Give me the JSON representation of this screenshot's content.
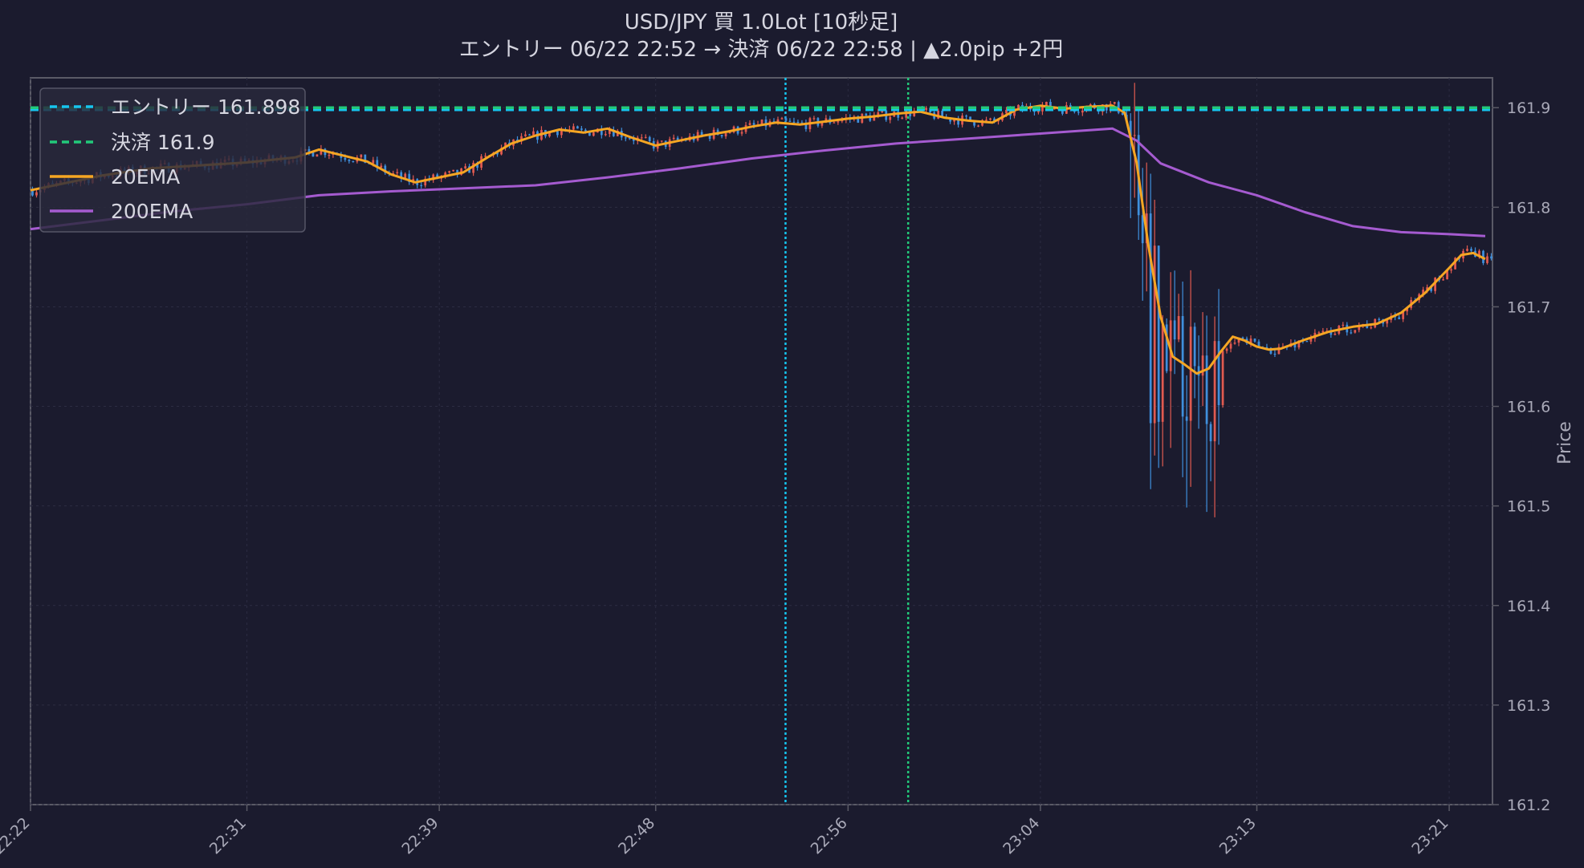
{
  "chart_data": {
    "type": "candlestick",
    "title": "USD/JPY  買  1.0Lot  [10秒足]",
    "subtitle": "エントリー 06/22 22:52  →  決済 06/22 22:58  |  ▲2.0pip  +2円",
    "ylabel": "Price",
    "xlabel": "",
    "ylim": [
      161.2,
      161.93
    ],
    "y_ticks": [
      "161.2",
      "161.3",
      "161.4",
      "161.5",
      "161.6",
      "161.7",
      "161.8",
      "161.9"
    ],
    "x_ticks": [
      "22:22",
      "22:31",
      "22:39",
      "22:48",
      "22:56",
      "23:04",
      "23:13",
      "23:21"
    ],
    "grid": true,
    "legend_position": "top-left",
    "entry_price": 161.898,
    "exit_price": 161.9,
    "entry_time": "22:52",
    "exit_time": "22:58",
    "series": [
      {
        "name": "エントリー 161.898",
        "kind": "hline",
        "value": 161.898,
        "color": "#16c5ee",
        "style": "dashed"
      },
      {
        "name": "決済 161.9",
        "kind": "hline",
        "value": 161.9,
        "color": "#22c97a",
        "style": "dashed"
      },
      {
        "name": "20EMA",
        "kind": "line",
        "color": "#f5a623"
      },
      {
        "name": "200EMA",
        "kind": "line",
        "color": "#a55bd0"
      }
    ],
    "ema20": [
      [
        "22:22",
        161.817
      ],
      [
        "22:23",
        161.822
      ],
      [
        "22:25",
        161.832
      ],
      [
        "22:27",
        161.839
      ],
      [
        "22:29",
        161.842
      ],
      [
        "22:31",
        161.845
      ],
      [
        "22:33",
        161.85
      ],
      [
        "22:34",
        161.858
      ],
      [
        "22:36",
        161.846
      ],
      [
        "22:37",
        161.833
      ],
      [
        "22:38",
        161.825
      ],
      [
        "22:39",
        161.83
      ],
      [
        "22:40",
        161.835
      ],
      [
        "22:41",
        161.85
      ],
      [
        "22:42",
        161.864
      ],
      [
        "22:43",
        161.872
      ],
      [
        "22:44",
        161.878
      ],
      [
        "22:45",
        161.875
      ],
      [
        "22:46",
        161.879
      ],
      [
        "22:47",
        161.87
      ],
      [
        "22:48",
        161.862
      ],
      [
        "22:49",
        161.867
      ],
      [
        "22:50",
        161.872
      ],
      [
        "22:51",
        161.876
      ],
      [
        "22:52",
        161.881
      ],
      [
        "22:53",
        161.885
      ],
      [
        "22:54",
        161.883
      ],
      [
        "22:55",
        161.886
      ],
      [
        "22:56",
        161.889
      ],
      [
        "22:57",
        161.891
      ],
      [
        "22:58",
        161.894
      ],
      [
        "22:59",
        161.896
      ],
      [
        "23:00",
        161.89
      ],
      [
        "23:01",
        161.887
      ],
      [
        "23:02",
        161.885
      ],
      [
        "23:03",
        161.898
      ],
      [
        "23:04",
        161.902
      ],
      [
        "23:05",
        161.899
      ],
      [
        "23:06",
        161.901
      ],
      [
        "23:07",
        161.902
      ],
      [
        "23:07.5",
        161.895
      ],
      [
        "23:08",
        161.845
      ],
      [
        "23:08.5",
        161.76
      ],
      [
        "23:09",
        161.69
      ],
      [
        "23:09.5",
        161.65
      ],
      [
        "23:10",
        161.642
      ],
      [
        "23:10.5",
        161.633
      ],
      [
        "23:11",
        161.638
      ],
      [
        "23:11.5",
        161.655
      ],
      [
        "23:12",
        161.67
      ],
      [
        "23:12.5",
        161.666
      ],
      [
        "23:13",
        161.66
      ],
      [
        "23:13.5",
        161.657
      ],
      [
        "23:14",
        161.658
      ],
      [
        "23:15",
        161.667
      ],
      [
        "23:16",
        161.675
      ],
      [
        "23:17",
        161.68
      ],
      [
        "23:18",
        161.683
      ],
      [
        "23:19",
        161.694
      ],
      [
        "23:20",
        161.714
      ],
      [
        "23:21",
        161.739
      ],
      [
        "23:21.5",
        161.752
      ],
      [
        "23:22",
        161.754
      ],
      [
        "23:22.5",
        161.748
      ]
    ],
    "ema200": [
      [
        "22:22",
        161.778
      ],
      [
        "22:25",
        161.787
      ],
      [
        "22:28",
        161.796
      ],
      [
        "22:31",
        161.803
      ],
      [
        "22:34",
        161.812
      ],
      [
        "22:37",
        161.816
      ],
      [
        "22:40",
        161.819
      ],
      [
        "22:43",
        161.822
      ],
      [
        "22:46",
        161.83
      ],
      [
        "22:49",
        161.839
      ],
      [
        "22:52",
        161.849
      ],
      [
        "22:55",
        161.857
      ],
      [
        "22:58",
        161.864
      ],
      [
        "23:01",
        161.869
      ],
      [
        "23:04",
        161.874
      ],
      [
        "23:07",
        161.879
      ],
      [
        "23:08",
        161.867
      ],
      [
        "23:09",
        161.844
      ],
      [
        "23:11",
        161.825
      ],
      [
        "23:13",
        161.812
      ],
      [
        "23:15",
        161.795
      ],
      [
        "23:17",
        161.781
      ],
      [
        "23:19",
        161.775
      ],
      [
        "23:21",
        161.773
      ],
      [
        "23:22.5",
        161.771
      ]
    ]
  }
}
